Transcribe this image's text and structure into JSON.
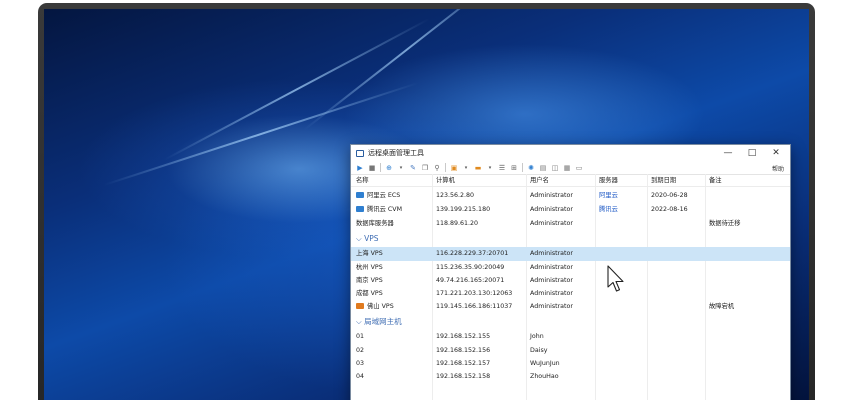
{
  "window": {
    "title": "远程桌面管理工具",
    "minimize": "—",
    "maximize": "□",
    "close": "✕"
  },
  "toolbar": {
    "help": "帮助"
  },
  "columns": {
    "name": "名称",
    "computer": "计算机",
    "user": "用户名",
    "server": "服务器",
    "expiry": "到期日期",
    "note": "备注"
  },
  "cloud_rows": [
    {
      "name": "阿里云 ECS",
      "computer": "123.56.2.80",
      "user": "Administrator",
      "server": "阿里云",
      "expiry": "2020-06-28",
      "note": ""
    },
    {
      "name": "腾讯云 CVM",
      "computer": "139.199.215.180",
      "user": "Administrator",
      "server": "腾讯云",
      "expiry": "2022-08-16",
      "note": ""
    },
    {
      "name": "数据库服务器",
      "computer": "118.89.61.20",
      "user": "Administrator",
      "server": "",
      "expiry": "",
      "note": "数据待迁移"
    }
  ],
  "groups": {
    "vps": "VPS",
    "lan": "局域网主机"
  },
  "vps_rows": [
    {
      "name": "上海 VPS",
      "computer": "116.228.229.37:20701",
      "user": "Administrator",
      "note": ""
    },
    {
      "name": "杭州 VPS",
      "computer": "115.236.35.90:20049",
      "user": "Administrator",
      "note": ""
    },
    {
      "name": "南京 VPS",
      "computer": "49.74.216.165:20071",
      "user": "Administrator",
      "note": ""
    },
    {
      "name": "成都 VPS",
      "computer": "171.221.203.130:12063",
      "user": "Administrator",
      "note": ""
    },
    {
      "name": "佛山 VPS",
      "computer": "119.145.166.186:11037",
      "user": "Administrator",
      "note": "故障宕机"
    }
  ],
  "lan_rows": [
    {
      "name": "01",
      "computer": "192.168.152.155",
      "user": "John"
    },
    {
      "name": "02",
      "computer": "192.168.152.156",
      "user": "Daisy"
    },
    {
      "name": "03",
      "computer": "192.168.152.157",
      "user": "WuJunJun"
    },
    {
      "name": "04",
      "computer": "192.168.152.158",
      "user": "ZhouHao"
    }
  ],
  "colors": {
    "accent": "#1a56c4",
    "group": "#3f6db3",
    "selected": "#cce4f7",
    "monitor_blue": "#2f7fd0",
    "monitor_orange": "#e07a1f"
  },
  "icons": [
    "monitor-icon",
    "play-icon",
    "stop-icon",
    "add-icon",
    "edit-icon",
    "search-icon",
    "settings-icon"
  ]
}
